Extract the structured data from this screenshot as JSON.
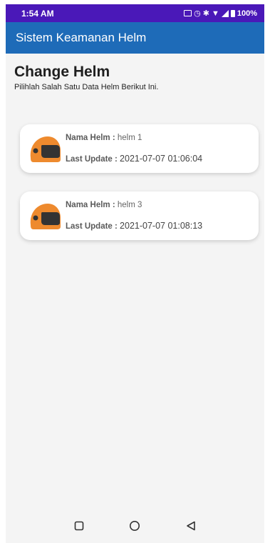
{
  "status_bar": {
    "time": "1:54 AM",
    "battery": "100%",
    "icons": [
      "keyboard-icon",
      "alarm-icon",
      "bluetooth-icon",
      "wifi-icon",
      "signal-icon",
      "battery-icon"
    ]
  },
  "app_bar": {
    "title": "Sistem Keamanan Helm"
  },
  "page": {
    "title": "Change Helm",
    "subtitle": "Pilihlah Salah Satu Data Helm Berikut Ini."
  },
  "helmets": [
    {
      "name_label": "Nama Helm :",
      "name": "helm 1",
      "update_label": "Last Update :",
      "last_update": "2021-07-07 01:06:04"
    },
    {
      "name_label": "Nama Helm :",
      "name": "helm 3",
      "update_label": "Last Update :",
      "last_update": "2021-07-07 01:08:13"
    }
  ],
  "nav_bar": {
    "icons": [
      "recent-apps-icon",
      "home-icon",
      "back-icon"
    ]
  },
  "colors": {
    "status_bar": "#4a18b8",
    "app_bar": "#1e6bb8",
    "helmet_orange": "#ee8a2e",
    "visor": "#333333"
  }
}
